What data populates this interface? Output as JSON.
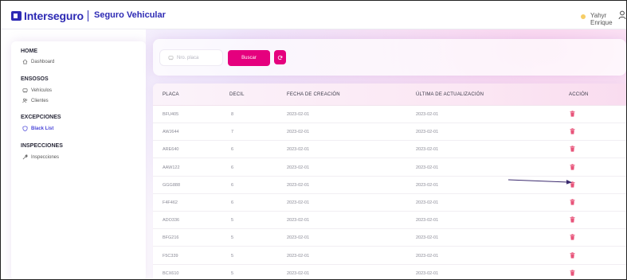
{
  "header": {
    "brand": "Interseguro",
    "product": "Seguro Vehicular",
    "user_name": "Yahyr Enrique"
  },
  "sidebar": {
    "sections": [
      {
        "title": "HOME",
        "items": [
          {
            "label": "Dashboard",
            "icon": "home-icon",
            "active": false
          }
        ]
      },
      {
        "title": "ENSOSOS",
        "items": [
          {
            "label": "Vehículos",
            "icon": "car-icon",
            "active": false
          },
          {
            "label": "Clientes",
            "icon": "users-icon",
            "active": false
          }
        ]
      },
      {
        "title": "EXCEPCIONES",
        "items": [
          {
            "label": "Black List",
            "icon": "shield-icon",
            "active": true
          }
        ]
      },
      {
        "title": "INSPECCIONES",
        "items": [
          {
            "label": "Inspecciones",
            "icon": "wrench-icon",
            "active": false
          }
        ]
      }
    ]
  },
  "search": {
    "placeholder": "Nro. placa",
    "button_label": "Buscar"
  },
  "table": {
    "headers": [
      "PLACA",
      "DECIL",
      "FECHA DE CREACIÓN",
      "ÚLTIMA DE ACTUALIZACIÓN",
      "ACCIÓN"
    ],
    "rows": [
      {
        "placa": "BFU405",
        "decil": "8",
        "creacion": "2023-02-01",
        "actualizacion": "2023-02-01"
      },
      {
        "placa": "AWJ644",
        "decil": "7",
        "creacion": "2023-02-01",
        "actualizacion": "2023-02-01"
      },
      {
        "placa": "ARE640",
        "decil": "6",
        "creacion": "2023-02-01",
        "actualizacion": "2023-02-01"
      },
      {
        "placa": "AAW122",
        "decil": "6",
        "creacion": "2023-02-01",
        "actualizacion": "2023-02-01"
      },
      {
        "placa": "GGG888",
        "decil": "6",
        "creacion": "2023-02-01",
        "actualizacion": "2023-02-01"
      },
      {
        "placa": "F4F462",
        "decil": "6",
        "creacion": "2023-02-01",
        "actualizacion": "2023-02-01"
      },
      {
        "placa": "ADO336",
        "decil": "5",
        "creacion": "2023-02-01",
        "actualizacion": "2023-02-01"
      },
      {
        "placa": "BFG216",
        "decil": "5",
        "creacion": "2023-02-01",
        "actualizacion": "2023-02-01"
      },
      {
        "placa": "F5C339",
        "decil": "5",
        "creacion": "2023-02-01",
        "actualizacion": "2023-02-01"
      },
      {
        "placa": "BCX610",
        "decil": "5",
        "creacion": "2023-02-01",
        "actualizacion": "2023-02-01"
      }
    ],
    "action_icon": "trash-icon"
  },
  "colors": {
    "brand": "#2d2ab4",
    "accent": "#e5007e",
    "active_nav": "#4a46d8",
    "trash": "#e8547a",
    "arrow": "#3b2a6e"
  }
}
